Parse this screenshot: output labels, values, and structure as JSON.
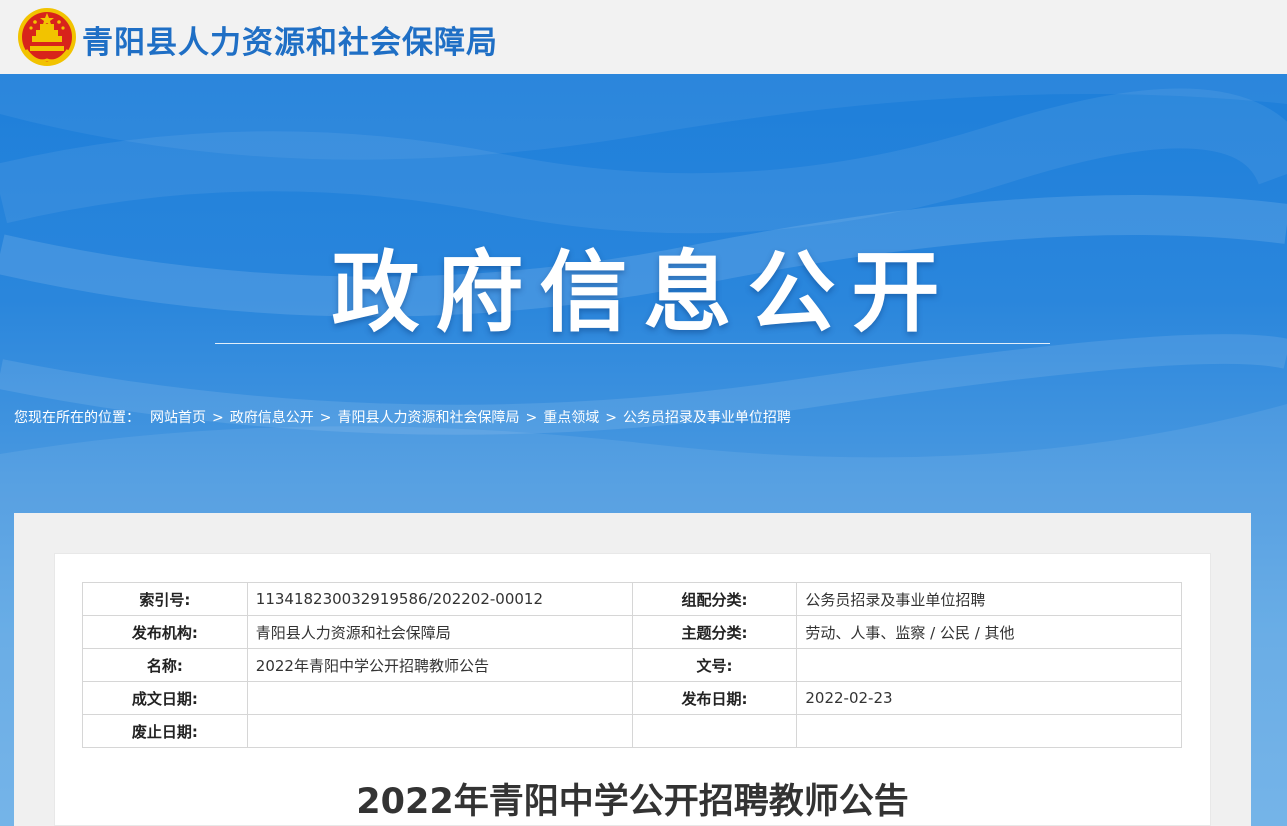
{
  "header": {
    "site_title": "青阳县人力资源和社会保障局"
  },
  "banner": {
    "title": "政府信息公开"
  },
  "breadcrumb": {
    "prefix": "您现在所在的位置：",
    "items": [
      "网站首页",
      "政府信息公开",
      "青阳县人力资源和社会保障局",
      "重点领域",
      "公务员招录及事业单位招聘"
    ],
    "separator": ">"
  },
  "meta": {
    "rows": [
      {
        "k1": "索引号:",
        "v1": "11341823003291958​6/202202-00012",
        "k2": "组配分类:",
        "v2": "公务员招录及事业单位招聘"
      },
      {
        "k1": "发布机构:",
        "v1": "青阳县人力资源和社会保障局",
        "k2": "主题分类:",
        "v2": "劳动、人事、监察 / 公民 / 其他"
      },
      {
        "k1": "名称:",
        "v1": "2022年青阳中学公开招聘教师公告",
        "k2": "文号:",
        "v2": ""
      },
      {
        "k1": "成文日期:",
        "v1": "",
        "k2": "发布日期:",
        "v2": "2022-02-23"
      },
      {
        "k1": "废止日期:",
        "v1": "",
        "k2": "",
        "v2": ""
      }
    ]
  },
  "article": {
    "title": "2022年青阳中学公开招聘教师公告"
  },
  "colors": {
    "brand_blue": "#1f6fc5",
    "banner_blue": "#1e7fda",
    "emblem_red": "#d8231b",
    "emblem_gold": "#f2c300"
  },
  "icons": {
    "emblem": "national-emblem-icon"
  }
}
